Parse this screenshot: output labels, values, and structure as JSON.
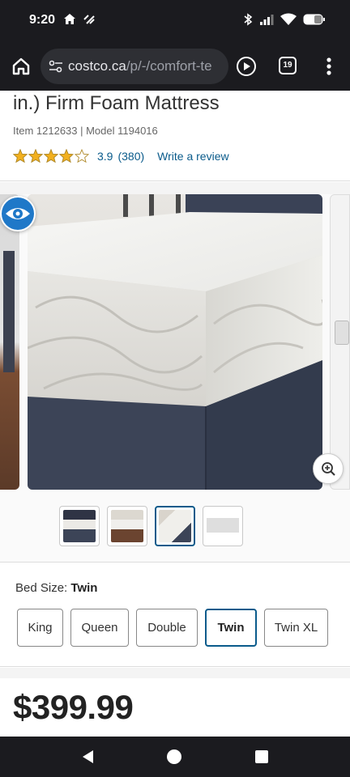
{
  "status_bar": {
    "time": "9:20",
    "left_icons": [
      "home-icon",
      "signal-assist-icon"
    ],
    "right_icons": [
      "bluetooth-icon",
      "cell-signal-icon",
      "wifi-icon",
      "battery-icon"
    ]
  },
  "browser": {
    "url_domain": "costco.ca",
    "url_path": "/p/-/comfort-te",
    "tab_count": "19"
  },
  "product": {
    "title": "in.) Firm Foam Mattress",
    "item_line": "Item 1212633 | Model 1194016",
    "rating_value": "3.9",
    "rating_count": "(380)",
    "stars_filled": 3.9,
    "stars_total": 5,
    "write_review": "Write a review"
  },
  "gallery": {
    "thumbnails": [
      "bed-frame-dark",
      "bed-frame-room",
      "mattress-corner",
      "mattress-white"
    ],
    "selected_index": 2
  },
  "bed_size": {
    "label": "Bed Size:",
    "selected_value": "Twin",
    "options": [
      "King",
      "Queen",
      "Double",
      "Twin",
      "Twin XL"
    ]
  },
  "price": "$399.99",
  "colors": {
    "accent": "#0a5b8b",
    "star": "#f2b01e",
    "eye_badge": "#1f78c8"
  }
}
